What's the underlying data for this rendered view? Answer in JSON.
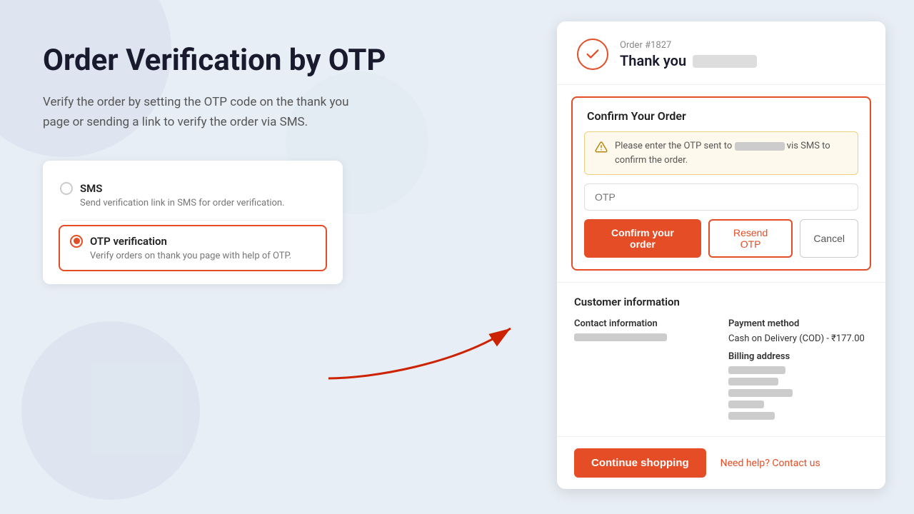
{
  "page": {
    "title": "Order Verification by OTP",
    "description": "Verify the order by setting the OTP code on the thank you page or sending a link to verify the order via SMS."
  },
  "options_card": {
    "sms": {
      "label": "SMS",
      "description": "Send verification link in SMS for order verification.",
      "selected": false
    },
    "otp": {
      "label": "OTP verification",
      "description": "Verify orders on thank you page with help of OTP.",
      "selected": true
    }
  },
  "order_card": {
    "order_number": "Order #1827",
    "thank_you_text": "Thank you",
    "confirm_section": {
      "title": "Confirm Your Order",
      "warning_text": "Please enter the OTP sent to",
      "warning_suffix": "vis SMS to confirm the order.",
      "otp_placeholder": "OTP",
      "btn_confirm": "Confirm your order",
      "btn_resend": "Resend OTP",
      "btn_cancel": "Cancel"
    },
    "customer_info": {
      "title": "Customer information",
      "contact_label": "Contact information",
      "payment_label": "Payment method",
      "payment_value": "Cash on Delivery (COD) - ₹177.00",
      "billing_label": "Billing address"
    },
    "footer": {
      "continue_btn": "Continue shopping",
      "help_link": "Need help? Contact us"
    }
  },
  "colors": {
    "accent": "#e44d26",
    "bg": "#e8eef5",
    "white": "#ffffff"
  }
}
